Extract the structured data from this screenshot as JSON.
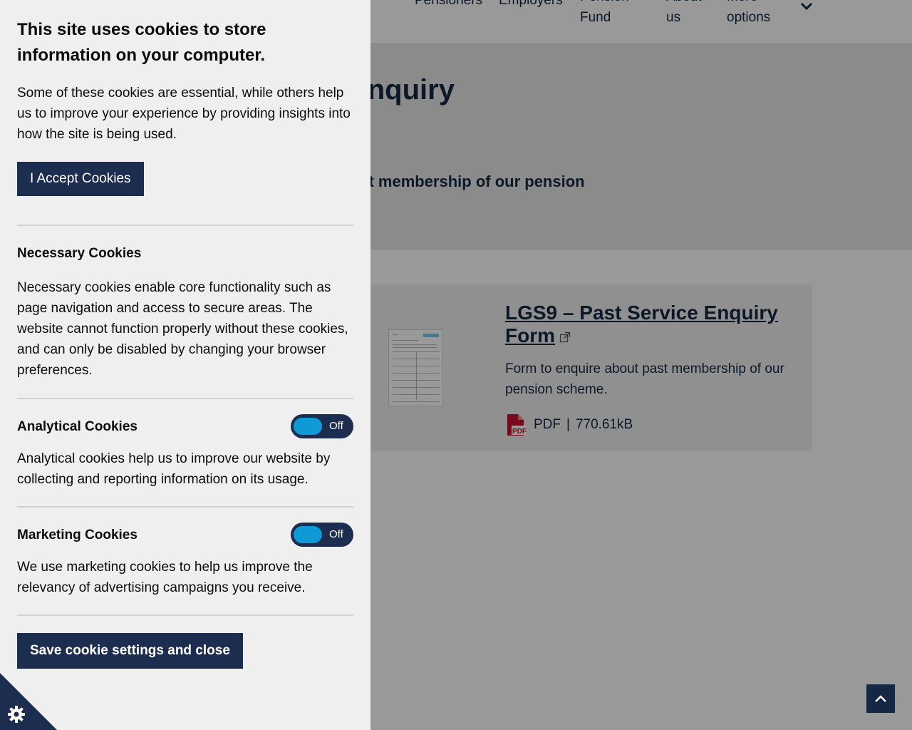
{
  "nav": {
    "items": [
      "Pensioners",
      "Employers",
      "Pension\nFund",
      "About\nus",
      "More\noptions"
    ]
  },
  "hero": {
    "title": "Past Service Enquiry",
    "subtitle": "Form to enquire about past membership of our pension"
  },
  "document": {
    "title": "LGS9 – Past Service Enquiry Form",
    "description": "Form to enquire about past membership of our pension scheme.",
    "file_type": "PDF",
    "separator": "|",
    "file_size": "770.61kB",
    "icon": "external-link-icon"
  },
  "cookie_banner": {
    "title": "This site uses cookies to store information on your computer.",
    "intro": "Some of these cookies are essential, while others help us to improve your experience by providing insights into how the site is being used.",
    "accept_label": "I Accept Cookies",
    "necessary": {
      "title": "Necessary Cookies",
      "text": "Necessary cookies enable core functionality such as page navigation and access to secure areas. The website cannot function properly without these cookies, and can only be disabled by changing your browser preferences."
    },
    "analytical": {
      "title": "Analytical Cookies",
      "toggle_label": "Off",
      "text": "Analytical cookies help us to improve our website by collecting and reporting information on its usage."
    },
    "marketing": {
      "title": "Marketing Cookies",
      "toggle_label": "Off",
      "text": "We use marketing cookies to help us improve the relevancy of advertising campaigns you receive."
    },
    "save_label": "Save cookie settings and close"
  },
  "colors": {
    "navy": "#1d2d50",
    "toggle_knob": "#0d9ad6",
    "panel_bg": "#efefef",
    "pdf_red": "#c8102e"
  }
}
